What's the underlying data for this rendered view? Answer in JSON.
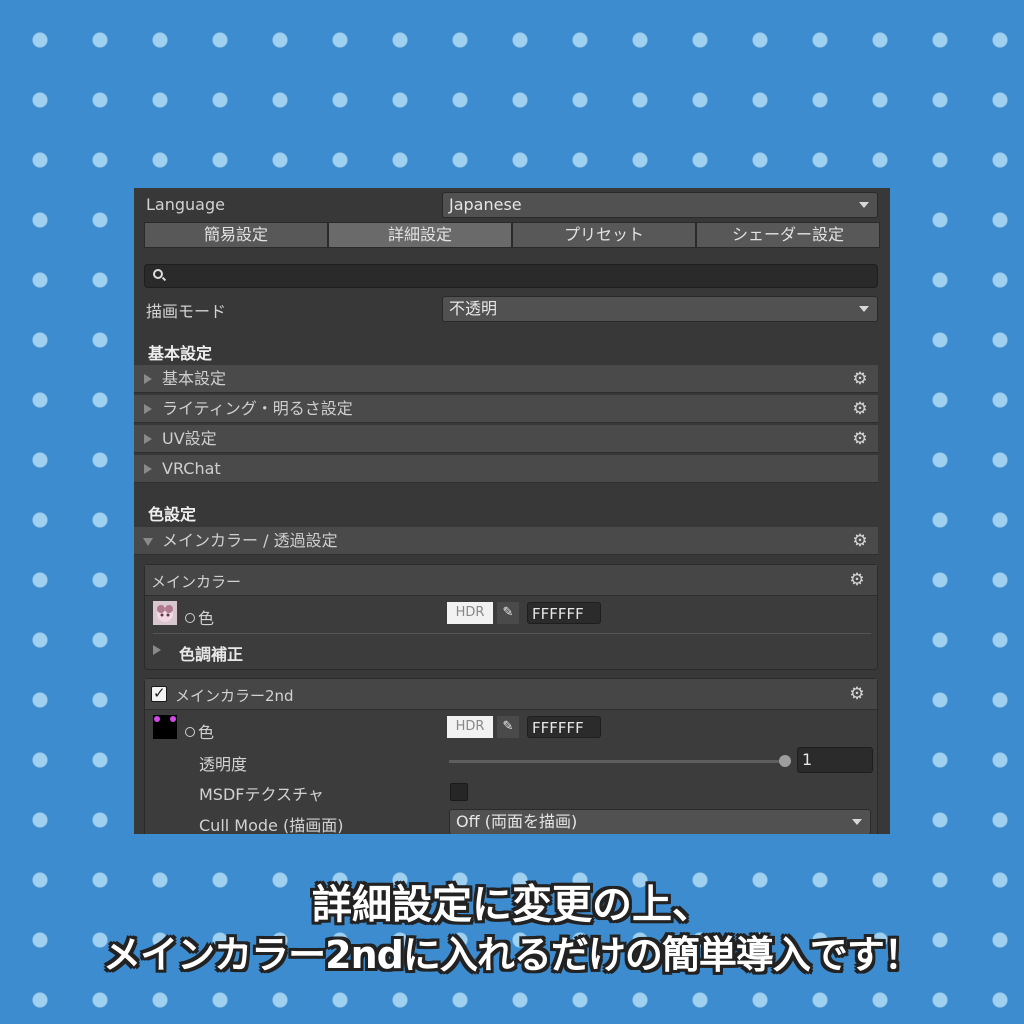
{
  "language": {
    "label": "Language",
    "value": "Japanese"
  },
  "tabs": [
    "簡易設定",
    "詳細設定",
    "プリセット",
    "シェーダー設定"
  ],
  "active_tab": 1,
  "render_mode": {
    "label": "描画モード",
    "value": "不透明"
  },
  "sections": {
    "basic": {
      "title": "基本設定",
      "items": [
        "基本設定",
        "ライティング・明るさ設定",
        "UV設定",
        "VRChat"
      ]
    },
    "color": {
      "title": "色設定",
      "foldout": "メインカラー / 透過設定"
    }
  },
  "main_color": {
    "title": "メインカラー",
    "color_label": "色",
    "hdr": "HDR",
    "hex": "FFFFFF",
    "tone_correction": "色調補正"
  },
  "main_color_2nd": {
    "title": "メインカラー2nd",
    "enabled": true,
    "color_label": "色",
    "hdr": "HDR",
    "hex": "FFFFFF",
    "opacity_label": "透明度",
    "opacity_value": "1",
    "msdf_label": "MSDFテクスチャ",
    "cull_label": "Cull Mode (描画面)",
    "cull_value": "Off (両面を描画)"
  },
  "caption": {
    "line1": "詳細設定に変更の上、",
    "line2": "メインカラー2ndに入れるだけの簡単導入です！"
  },
  "colors": {
    "background": "#3d8ccf",
    "dots": "#9fd0ef",
    "panel": "#383838"
  }
}
